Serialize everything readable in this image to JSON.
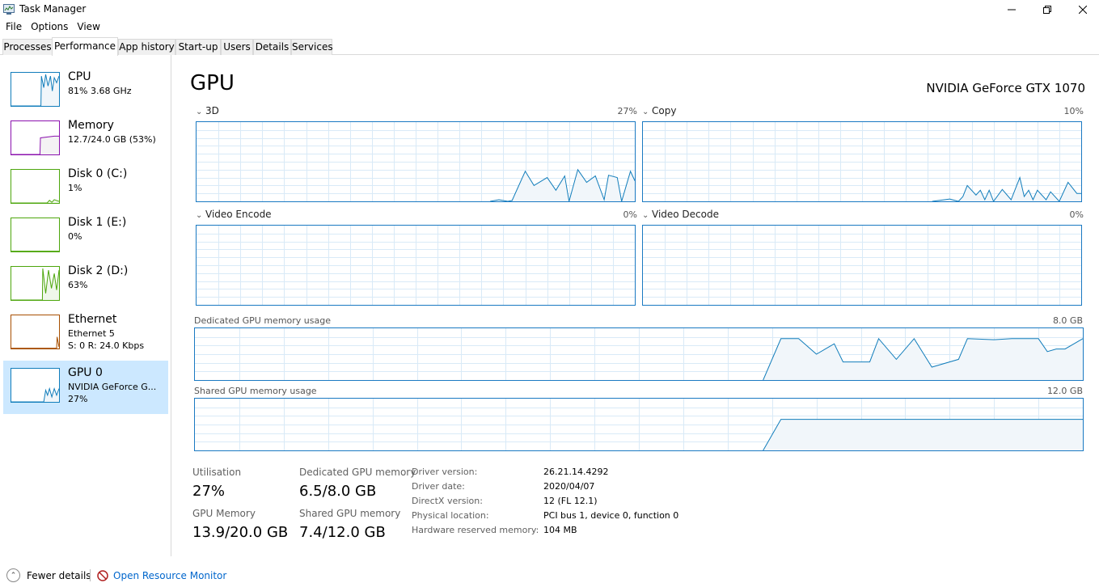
{
  "window": {
    "title": "Task Manager",
    "controls": {
      "minimize": "minimize-icon",
      "maximize": "maximize-icon",
      "close": "close-icon"
    }
  },
  "menu": [
    "File",
    "Options",
    "View"
  ],
  "tabs": [
    "Processes",
    "Performance",
    "App history",
    "Start-up",
    "Users",
    "Details",
    "Services"
  ],
  "active_tab": "Performance",
  "sidebar": {
    "items": [
      {
        "title": "CPU",
        "sub1": "81% 3.68 GHz",
        "sub2": "",
        "color": "#117dbb",
        "fill": "#f1f6fa",
        "usage": 81
      },
      {
        "title": "Memory",
        "sub1": "12.7/24.0 GB (53%)",
        "sub2": "",
        "color": "#8b12ae",
        "fill": "#f4f2f4",
        "usage": 53
      },
      {
        "title": "Disk 0 (C:)",
        "sub1": "1%",
        "sub2": "",
        "color": "#4da60c",
        "fill": "#eff7ea",
        "usage": 1
      },
      {
        "title": "Disk 1 (E:)",
        "sub1": "0%",
        "sub2": "",
        "color": "#4da60c",
        "fill": "#eff7ea",
        "usage": 0
      },
      {
        "title": "Disk 2 (D:)",
        "sub1": "63%",
        "sub2": "",
        "color": "#4da60c",
        "fill": "#eff7ea",
        "usage": 63
      },
      {
        "title": "Ethernet",
        "sub1": "Ethernet 5",
        "sub2": "S: 0 R: 24.0 Kbps",
        "color": "#a74f01",
        "fill": "#fcf3eb",
        "usage": 2
      },
      {
        "title": "GPU 0",
        "sub1": "NVIDIA GeForce G...",
        "sub2": "27%",
        "color": "#117dbb",
        "fill": "#f1f6fa",
        "usage": 27
      }
    ],
    "selected": "GPU 0"
  },
  "main": {
    "title": "GPU",
    "model": "NVIDIA GeForce GTX 1070",
    "engines": [
      {
        "label": "3D",
        "value": "27%"
      },
      {
        "label": "Copy",
        "value": "10%"
      },
      {
        "label": "Video Encode",
        "value": "0%"
      },
      {
        "label": "Video Decode",
        "value": "0%"
      }
    ],
    "dedicated": {
      "label": "Dedicated GPU memory usage",
      "max": "8.0 GB"
    },
    "shared": {
      "label": "Shared GPU memory usage",
      "max": "12.0 GB"
    },
    "stats": [
      {
        "label": "Utilisation",
        "value": "27%"
      },
      {
        "label": "Dedicated GPU memory",
        "value": "6.5/8.0 GB"
      },
      {
        "label": "GPU Memory",
        "value": "13.9/20.0 GB"
      },
      {
        "label": "Shared GPU memory",
        "value": "7.4/12.0 GB"
      }
    ],
    "info": [
      {
        "label": "Driver version:",
        "value": "26.21.14.4292"
      },
      {
        "label": "Driver date:",
        "value": "2020/04/07"
      },
      {
        "label": "DirectX version:",
        "value": "12 (FL 12.1)"
      },
      {
        "label": "Physical location:",
        "value": "PCI bus 1, device 0, function 0"
      },
      {
        "label": "Hardware reserved memory:",
        "value": "104 MB"
      }
    ]
  },
  "footer": {
    "fewer_details": "Fewer details",
    "open_resource_monitor": "Open Resource Monitor"
  },
  "colors": {
    "accent": "#117dbb",
    "selected_bg": "#cce8ff",
    "link": "#0066cc"
  }
}
